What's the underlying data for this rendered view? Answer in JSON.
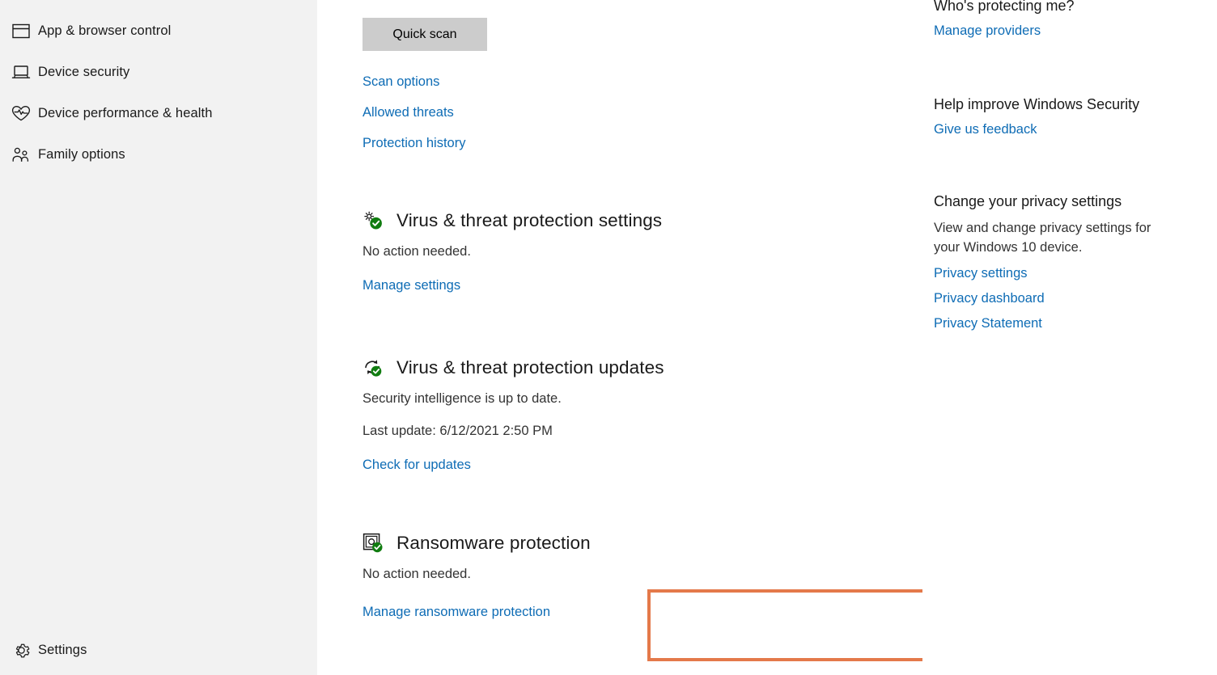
{
  "sidebar": {
    "items": [
      {
        "label": "App & browser control",
        "icon": "app-browser-control-icon"
      },
      {
        "label": "Device security",
        "icon": "device-security-icon"
      },
      {
        "label": "Device performance & health",
        "icon": "heart-pulse-icon"
      },
      {
        "label": "Family options",
        "icon": "family-people-icon"
      }
    ],
    "footer": {
      "label": "Settings",
      "icon": "gear-icon"
    }
  },
  "main": {
    "quick_scan_label": "Quick scan",
    "top_links": [
      "Scan options",
      "Allowed threats",
      "Protection history"
    ],
    "sections": [
      {
        "title": "Virus & threat protection settings",
        "status": "No action needed.",
        "link": "Manage settings",
        "icon": "gears-check-icon"
      },
      {
        "title": "Virus & threat protection updates",
        "status": "Security intelligence is up to date.",
        "status2": "Last update: 6/12/2021 2:50 PM",
        "link": "Check for updates",
        "icon": "refresh-check-icon"
      },
      {
        "title": "Ransomware protection",
        "status": "No action needed.",
        "link": "Manage ransomware protection",
        "icon": "ransomware-shield-check-icon"
      }
    ]
  },
  "right_panel": {
    "who": {
      "heading": "Who's protecting me?",
      "link": "Manage providers"
    },
    "help": {
      "heading": "Help improve Windows Security",
      "link": "Give us feedback"
    },
    "privacy": {
      "heading": "Change your privacy settings",
      "body": "View and change privacy settings for your Windows 10 device.",
      "links": [
        "Privacy settings",
        "Privacy dashboard",
        "Privacy Statement"
      ]
    }
  },
  "colors": {
    "link": "#0e6cb5",
    "sidebar_bg": "#f2f2f2",
    "button_bg": "#cccccc",
    "highlight_border": "#e4794a",
    "status_green": "#107c10",
    "text": "#1a1a1a"
  }
}
